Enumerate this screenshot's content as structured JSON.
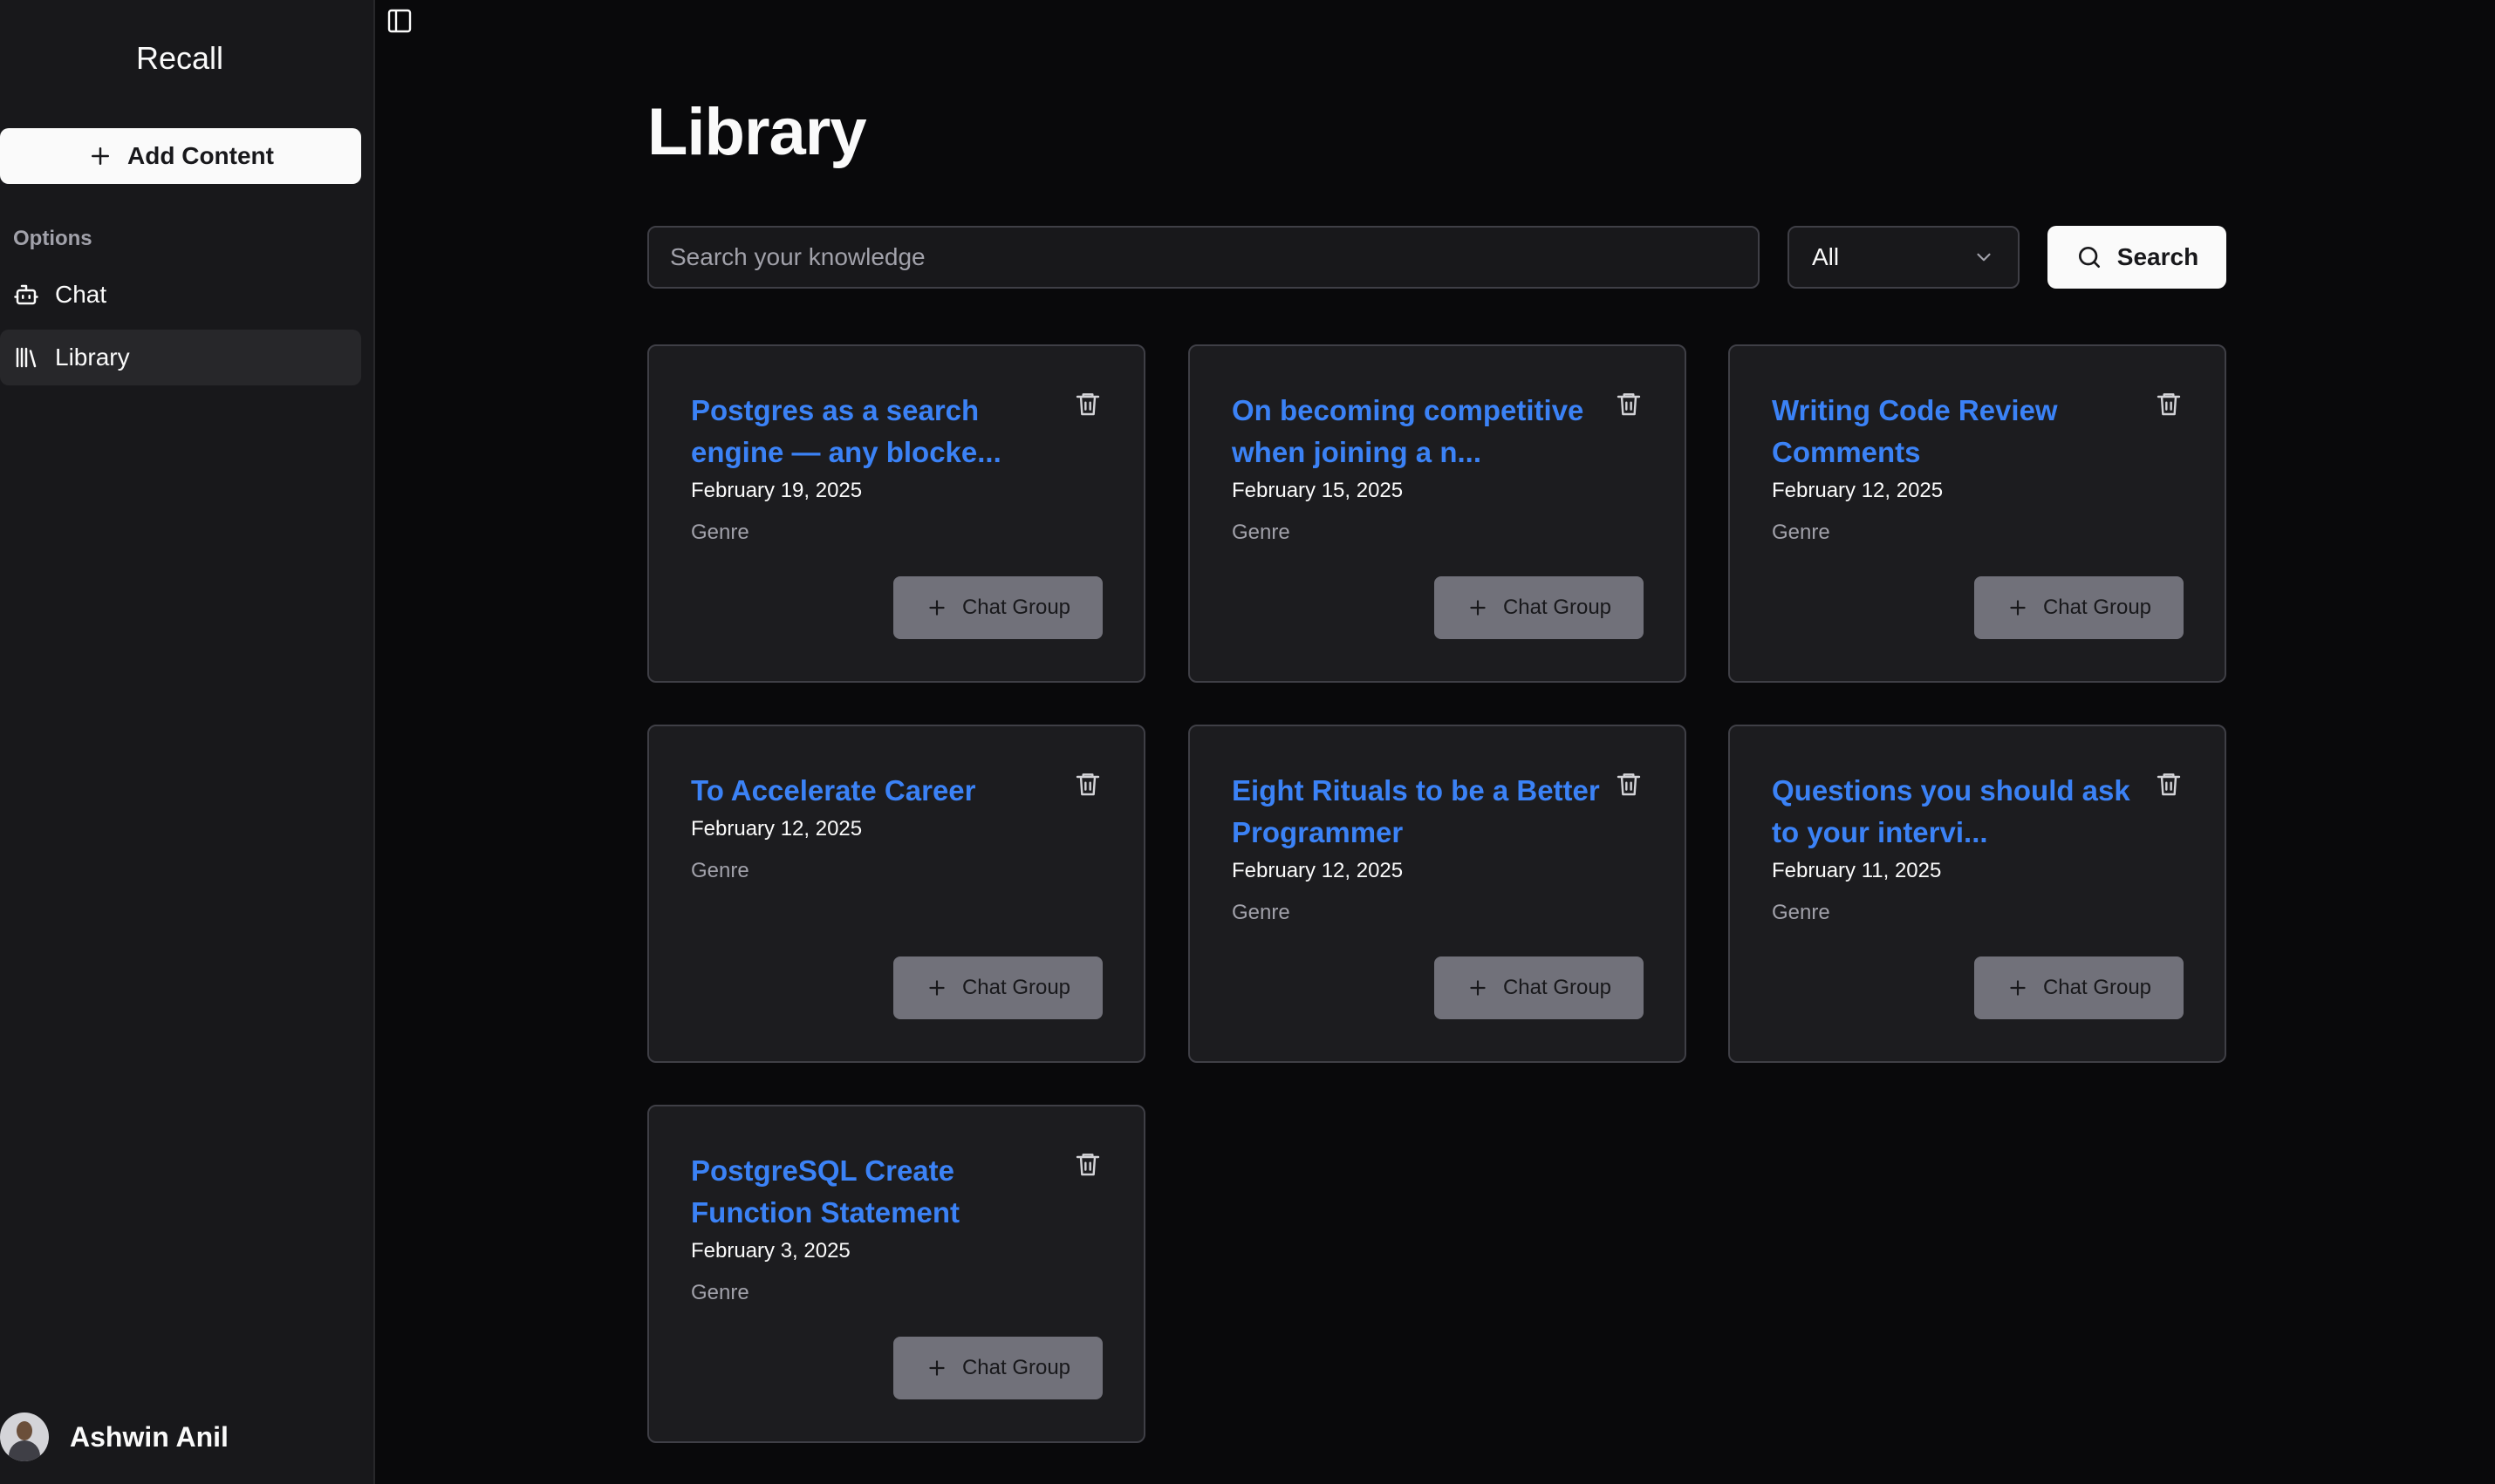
{
  "sidebar": {
    "app_title": "Recall",
    "add_content_label": "Add Content",
    "section_label": "Options",
    "nav": [
      {
        "label": "Chat",
        "icon": "bot-icon",
        "active": false
      },
      {
        "label": "Library",
        "icon": "library-icon",
        "active": true
      }
    ],
    "user": {
      "name": "Ashwin Anil"
    }
  },
  "main": {
    "title": "Library",
    "search": {
      "placeholder": "Search your knowledge",
      "value": ""
    },
    "filter": {
      "selected": "All"
    },
    "search_button_label": "Search",
    "cards": [
      {
        "title": "Postgres as a search engine — any blocke...",
        "date": "February 19, 2025",
        "genre": "Genre",
        "action": "Chat Group"
      },
      {
        "title": "On becoming competitive when joining a n...",
        "date": "February 15, 2025",
        "genre": "Genre",
        "action": "Chat Group"
      },
      {
        "title": "Writing Code Review Comments",
        "date": "February 12, 2025",
        "genre": "Genre",
        "action": "Chat Group"
      },
      {
        "title": "To Accelerate Career",
        "date": "February 12, 2025",
        "genre": "Genre",
        "action": "Chat Group"
      },
      {
        "title": "Eight Rituals to be a Better Programmer",
        "date": "February 12, 2025",
        "genre": "Genre",
        "action": "Chat Group"
      },
      {
        "title": "Questions you should ask to your intervi...",
        "date": "February 11, 2025",
        "genre": "Genre",
        "action": "Chat Group"
      },
      {
        "title": "PostgreSQL Create Function Statement",
        "date": "February 3, 2025",
        "genre": "Genre",
        "action": "Chat Group"
      }
    ]
  },
  "colors": {
    "background": "#09090b",
    "sidebar": "#18181b",
    "card": "#1c1c1f",
    "accent_link": "#3b82f6",
    "chat_button": "#71717a"
  }
}
